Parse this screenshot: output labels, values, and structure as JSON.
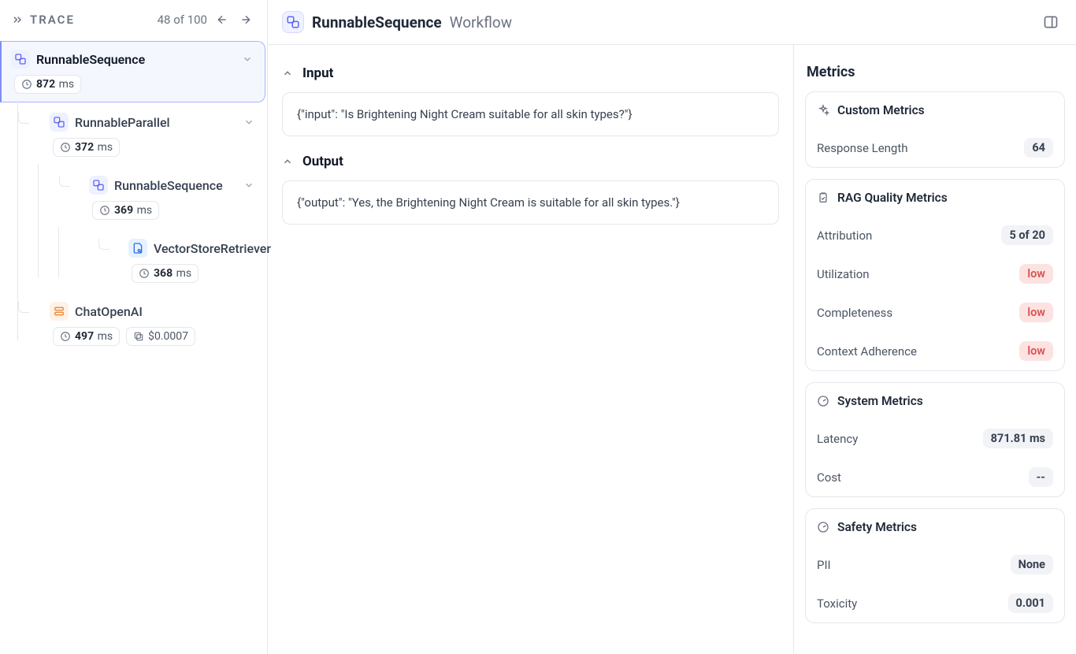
{
  "trace": {
    "title": "TRACE",
    "pager": "48 of 100"
  },
  "tree": {
    "root": {
      "label": "RunnableSequence",
      "time_value": "872",
      "time_unit": "ms"
    },
    "parallel": {
      "label": "RunnableParallel",
      "time_value": "372",
      "time_unit": "ms"
    },
    "seq_inner": {
      "label": "RunnableSequence",
      "time_value": "369",
      "time_unit": "ms"
    },
    "retriever": {
      "label": "VectorStoreRetriever",
      "time_value": "368",
      "time_unit": "ms"
    },
    "chat": {
      "label": "ChatOpenAI",
      "time_value": "497",
      "time_unit": "ms",
      "cost": "$0.0007"
    }
  },
  "header": {
    "name": "RunnableSequence",
    "subtitle": "Workflow"
  },
  "io": {
    "input_label": "Input",
    "input_value": "{\"input\": \"Is Brightening Night Cream suitable for all skin types?\"}",
    "output_label": "Output",
    "output_value": "{\"output\": \"Yes, the Brightening Night Cream is suitable for all skin types.\"}"
  },
  "metrics": {
    "title": "Metrics",
    "custom": {
      "title": "Custom Metrics",
      "response_length_label": "Response Length",
      "response_length_value": "64"
    },
    "rag": {
      "title": "RAG Quality Metrics",
      "attribution_label": "Attribution",
      "attribution_value": "5 of 20",
      "utilization_label": "Utilization",
      "utilization_value": "low",
      "completeness_label": "Completeness",
      "completeness_value": "low",
      "adherence_label": "Context Adherence",
      "adherence_value": "low"
    },
    "system": {
      "title": "System Metrics",
      "latency_label": "Latency",
      "latency_value": "871.81 ms",
      "cost_label": "Cost",
      "cost_value": "--"
    },
    "safety": {
      "title": "Safety Metrics",
      "pii_label": "PII",
      "pii_value": "None",
      "toxicity_label": "Toxicity",
      "toxicity_value": "0.001"
    }
  }
}
